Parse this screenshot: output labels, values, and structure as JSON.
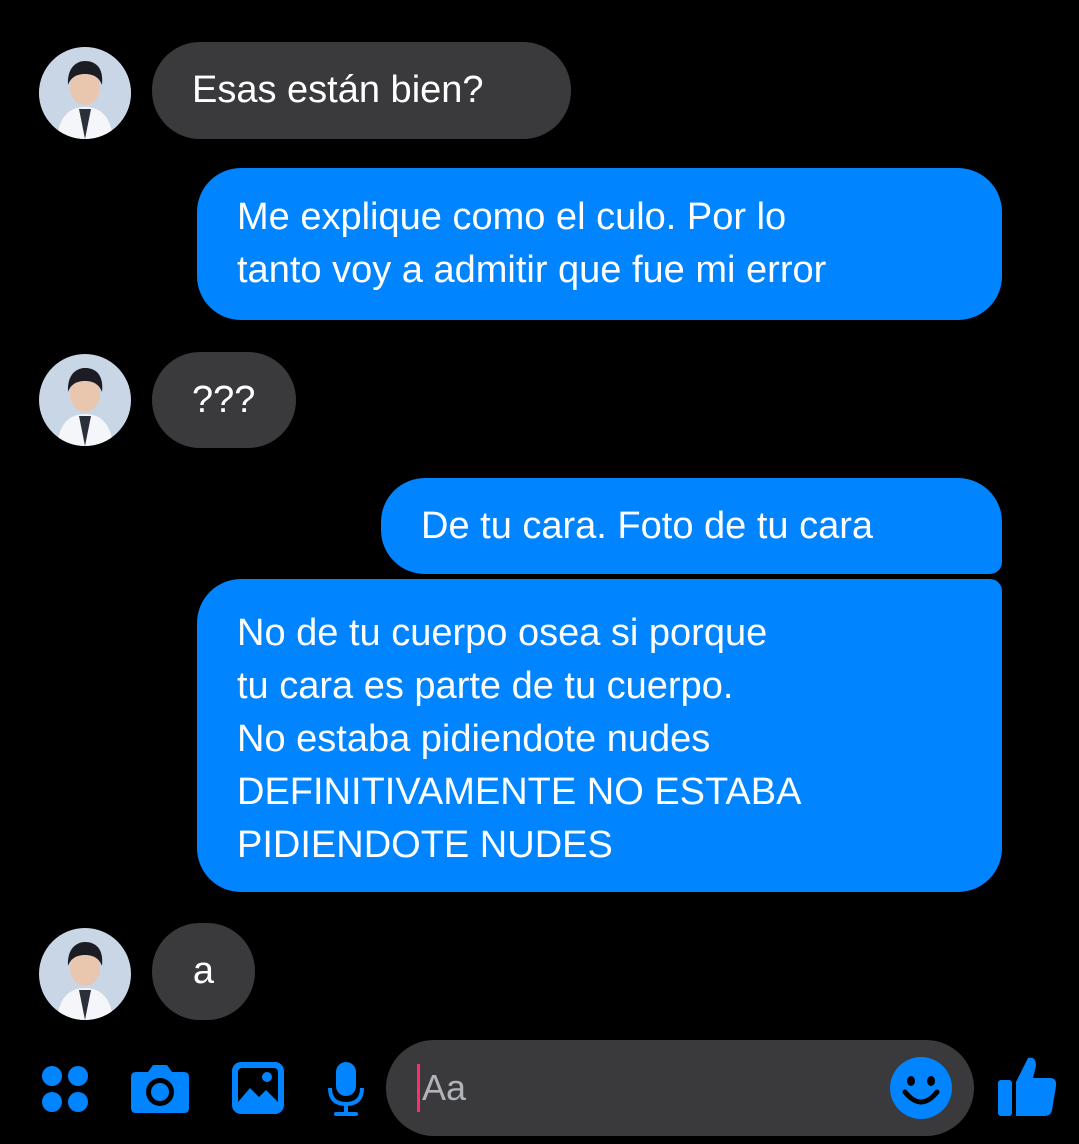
{
  "theme": {
    "background": "#000000",
    "incoming_bubble": "#3a3a3c",
    "outgoing_bubble": "#0084ff",
    "accent": "#0084ff",
    "caret": "#ff2d6f"
  },
  "messages": [
    {
      "direction": "incoming",
      "lines": [
        "Esas están bien?"
      ]
    },
    {
      "direction": "outgoing",
      "lines": [
        "Me explique como el culo. Por lo",
        "tanto voy a admitir que fue mi error"
      ]
    },
    {
      "direction": "incoming",
      "lines": [
        "???"
      ]
    },
    {
      "direction": "outgoing",
      "lines": [
        "De tu cara. Foto de tu cara"
      ]
    },
    {
      "direction": "outgoing",
      "lines": [
        "No de tu cuerpo osea si porque",
        "tu cara es parte de tu cuerpo.",
        "No estaba pidiendote nudes",
        "DEFINITIVAMENTE NO ESTABA",
        "PIDIENDOTE NUDES"
      ]
    },
    {
      "direction": "incoming",
      "lines": [
        "a"
      ]
    }
  ],
  "composer": {
    "placeholder": "Aa",
    "icons": [
      "apps-grid-icon",
      "camera-icon",
      "gallery-icon",
      "microphone-icon",
      "emoji-icon",
      "thumbs-up-icon"
    ]
  }
}
